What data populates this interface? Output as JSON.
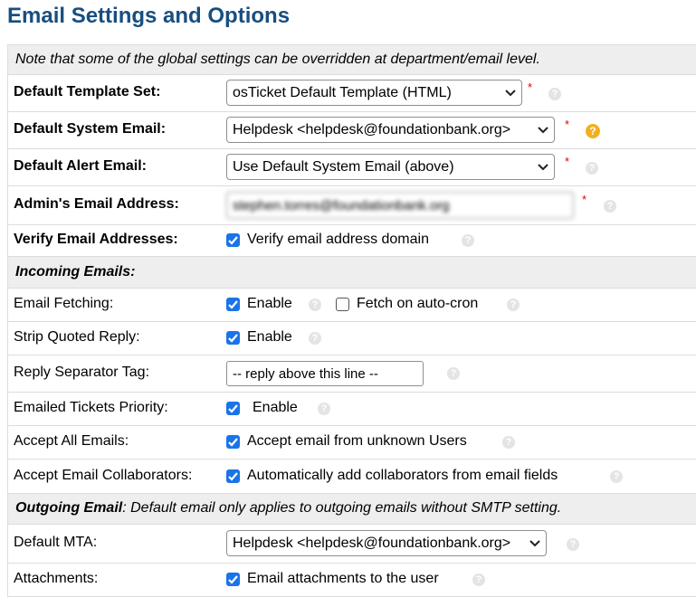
{
  "page_title": "Email Settings and Options",
  "note": "Note that some of the global settings can be overridden at department/email level.",
  "fields": {
    "template_set": {
      "label": "Default Template Set:",
      "value": "osTicket Default Template (HTML)"
    },
    "system_email": {
      "label": "Default System Email:",
      "value": "Helpdesk <helpdesk@foundationbank.org>"
    },
    "alert_email": {
      "label": "Default Alert Email:",
      "value": "Use Default System Email (above)"
    },
    "admin_email": {
      "label": "Admin's Email Address:",
      "value": "stephen.torres@foundationbank.org"
    },
    "verify": {
      "label": "Verify Email Addresses:",
      "checkbox": "Verify email address domain"
    }
  },
  "incoming": {
    "header": "Incoming Emails:",
    "fetching": {
      "label": "Email Fetching:",
      "enable": "Enable",
      "autocron": "Fetch on auto-cron"
    },
    "strip": {
      "label": "Strip Quoted Reply:",
      "enable": "Enable"
    },
    "separator": {
      "label": "Reply Separator Tag:",
      "value": "-- reply above this line --"
    },
    "priority": {
      "label": "Emailed Tickets Priority:",
      "enable": "Enable"
    },
    "accept_all": {
      "label": "Accept All Emails:",
      "checkbox": "Accept email from unknown Users"
    },
    "collaborators": {
      "label": "Accept Email Collaborators:",
      "checkbox": "Automatically add collaborators from email fields"
    }
  },
  "outgoing": {
    "header_bold": "Outgoing Email",
    "header_rest": ": Default email only applies to outgoing emails without SMTP setting.",
    "mta": {
      "label": "Default MTA:",
      "value": "Helpdesk <helpdesk@foundationbank.org>"
    },
    "attachments": {
      "label": "Attachments:",
      "checkbox": "Email attachments to the user"
    }
  },
  "symbols": {
    "required": "*",
    "help": "?"
  },
  "colors": {
    "title": "#184e81",
    "checkbox": "#1a73e8",
    "required": "#e00000",
    "warn": "#f2b01e"
  }
}
